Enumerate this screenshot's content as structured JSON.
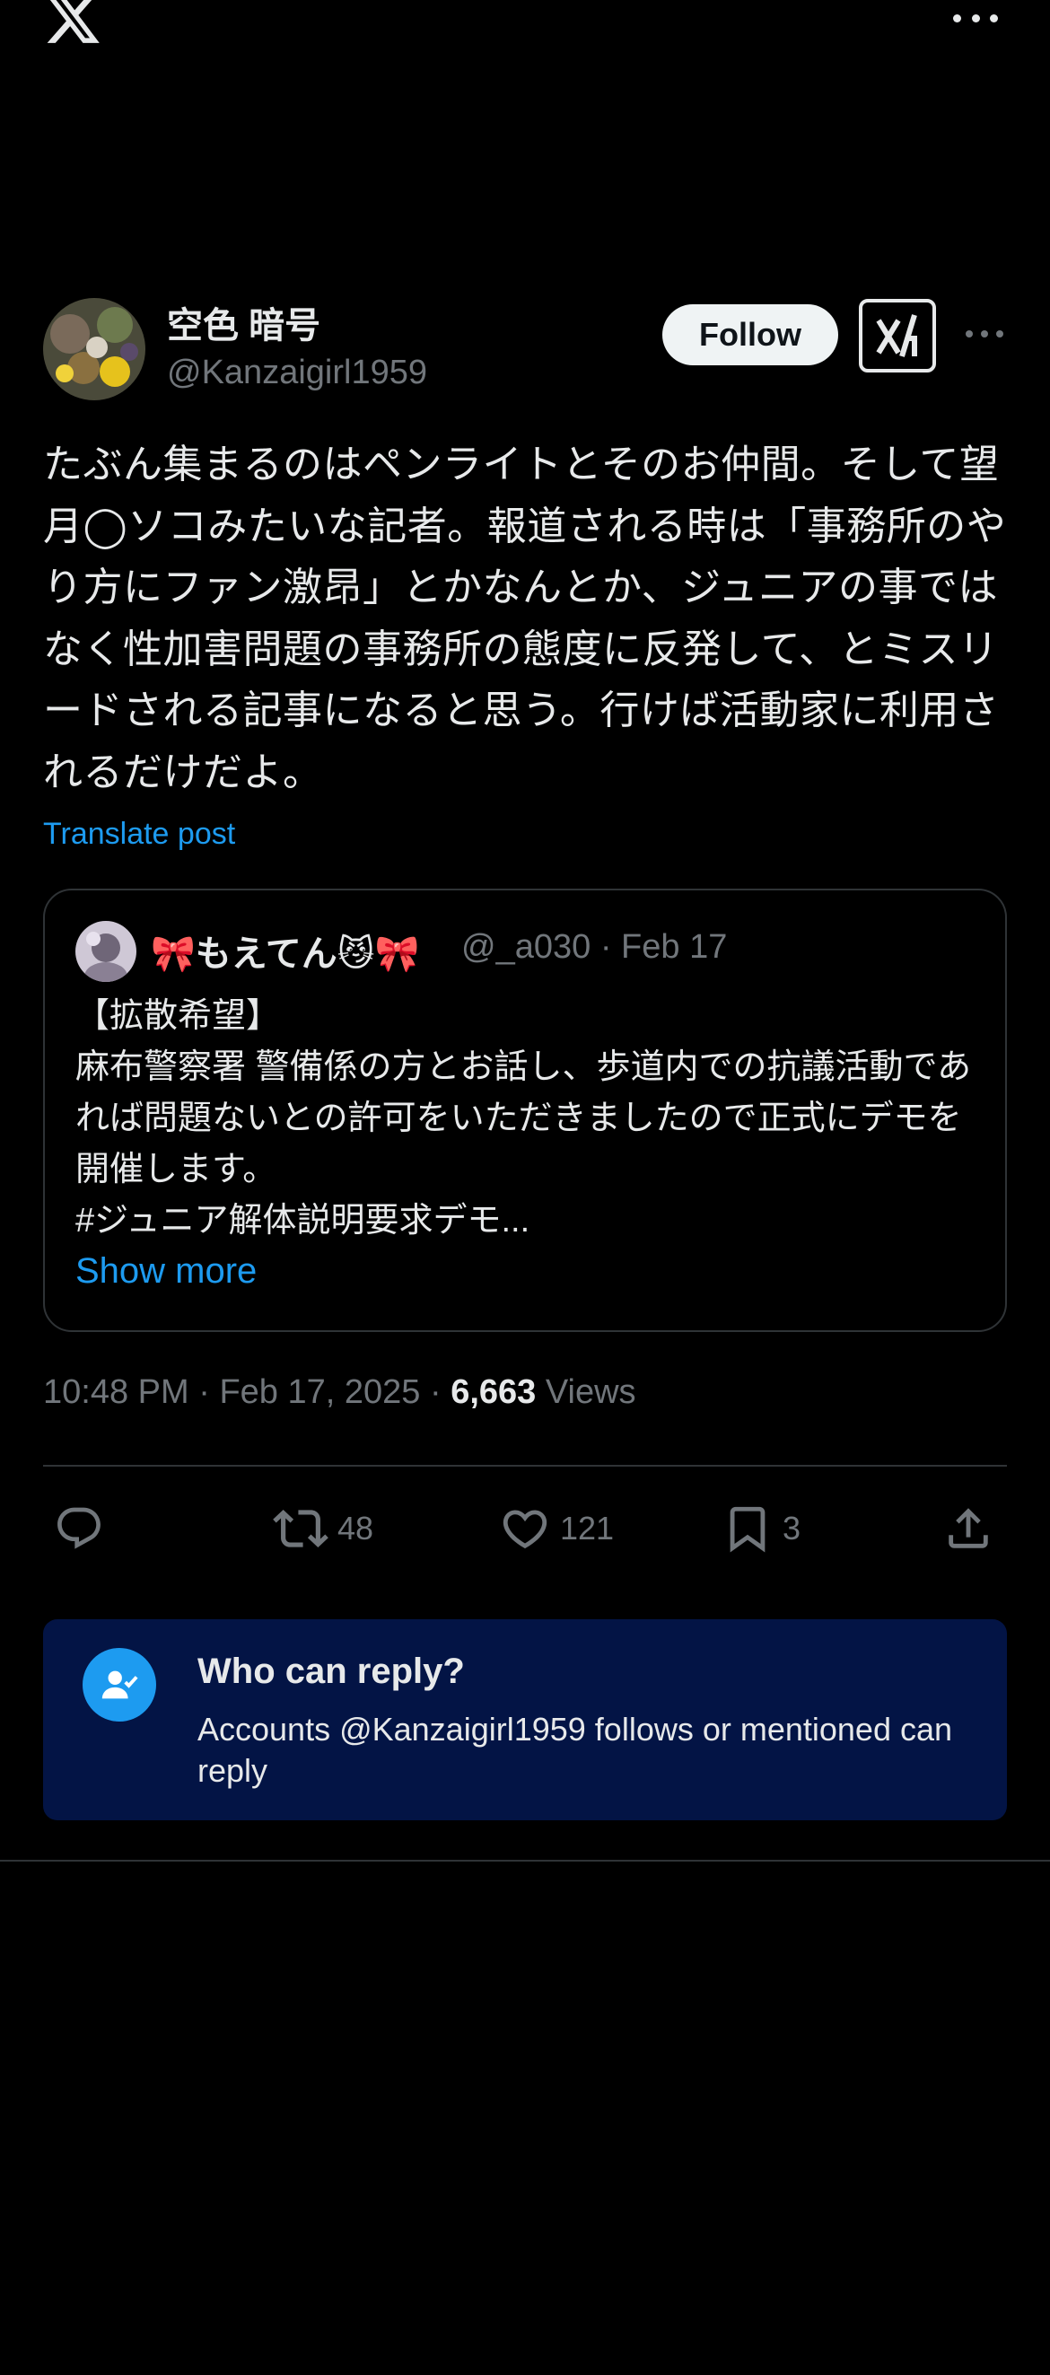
{
  "topbar": {
    "logo_icon": "x-logo-icon",
    "menu_icon": "more-horizontal-icon"
  },
  "author": {
    "display_name": "空色 暗号",
    "handle": "@Kanzaigirl1959",
    "follow_label": "Follow",
    "grok_icon": "grok-icon",
    "more_icon": "more-horizontal-icon"
  },
  "post": {
    "text": "たぶん集まるのはペンライトとそのお仲間。そして望月◯ソコみたいな記者。報道される時は「事務所のやり方にファン激昂」とかなんとか、ジュニアの事ではなく性加害問題の事務所の態度に反発して、とミスリードされる記事になると思う。行けば活動家に利用されるだけだよ。",
    "translate_label": "Translate post"
  },
  "quote": {
    "display_name": "🎀もえてん😼🎀",
    "handle": "@_a030",
    "date": "Feb 17",
    "text": "【拡散希望】\n麻布警察署 警備係の方とお話し、歩道内での抗議活動であれば問題ないとの許可をいただきましたので正式にデモを開催します。\n#ジュニア解体説明要求デモ...",
    "show_more_label": "Show more"
  },
  "meta": {
    "time": "10:48 PM",
    "date": "Feb 17, 2025",
    "views_count": "6,663",
    "views_label": "Views"
  },
  "actions": {
    "reply_icon": "reply-icon",
    "retweet_count": "48",
    "like_count": "121",
    "bookmark_count": "3",
    "share_icon": "share-icon"
  },
  "reply_settings": {
    "title": "Who can reply?",
    "description": "Accounts @Kanzaigirl1959 follows or mentioned can reply"
  },
  "colors": {
    "background": "#000000",
    "text": "#e7e9ea",
    "secondary": "#71767b",
    "accent": "#1d9bf0",
    "reply_box": "#031445"
  }
}
